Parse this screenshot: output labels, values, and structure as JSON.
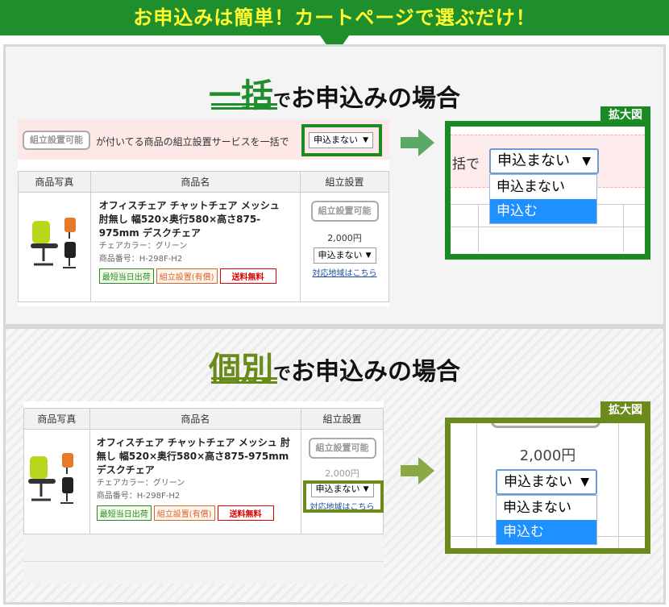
{
  "banner": {
    "text": "お申込みは簡単！カートページで選ぶだけ！"
  },
  "sections": [
    {
      "big": "一括",
      "de": "で",
      "rest": "お申込みの場合"
    },
    {
      "big": "個別",
      "de": "で",
      "rest": "お申込みの場合"
    }
  ],
  "service_bar": {
    "badge": "組立設置可能",
    "text": "が付いてる商品の組立設置サービスを一括で",
    "select_value": "申込まない"
  },
  "table": {
    "headers": [
      "商品写真",
      "商品名",
      "組立設置"
    ],
    "product_name": "オフィスチェア チャットチェア メッシュ 肘無し 幅520×奥行580×高さ875-975mm デスクチェア",
    "color_line": "チェアカラー：グリーン",
    "code_line": "商品番号：H-298F-H2",
    "tags": [
      "最短当日出荷",
      "組立設置(有償)",
      "送料無料"
    ],
    "assembly_badge": "組立設置可能",
    "price": "2,000円",
    "select_value": "申込まない",
    "region_link": "対応地域はこちら"
  },
  "zoom_label": "拡大図",
  "zoom1": {
    "prefix": "括で",
    "select_value": "申込まない",
    "options": [
      "申込まない",
      "申込む"
    ],
    "selected_option": "申込む"
  },
  "zoom2": {
    "price": "2,000円",
    "select_value": "申込まない",
    "options": [
      "申込まない",
      "申込む"
    ],
    "selected_option": "申込む"
  },
  "colors": {
    "banner_green": "#1f8f2e",
    "banner_text": "#fff92f",
    "olive": "#6a8a1a",
    "option_selected": "#1e90ff"
  }
}
